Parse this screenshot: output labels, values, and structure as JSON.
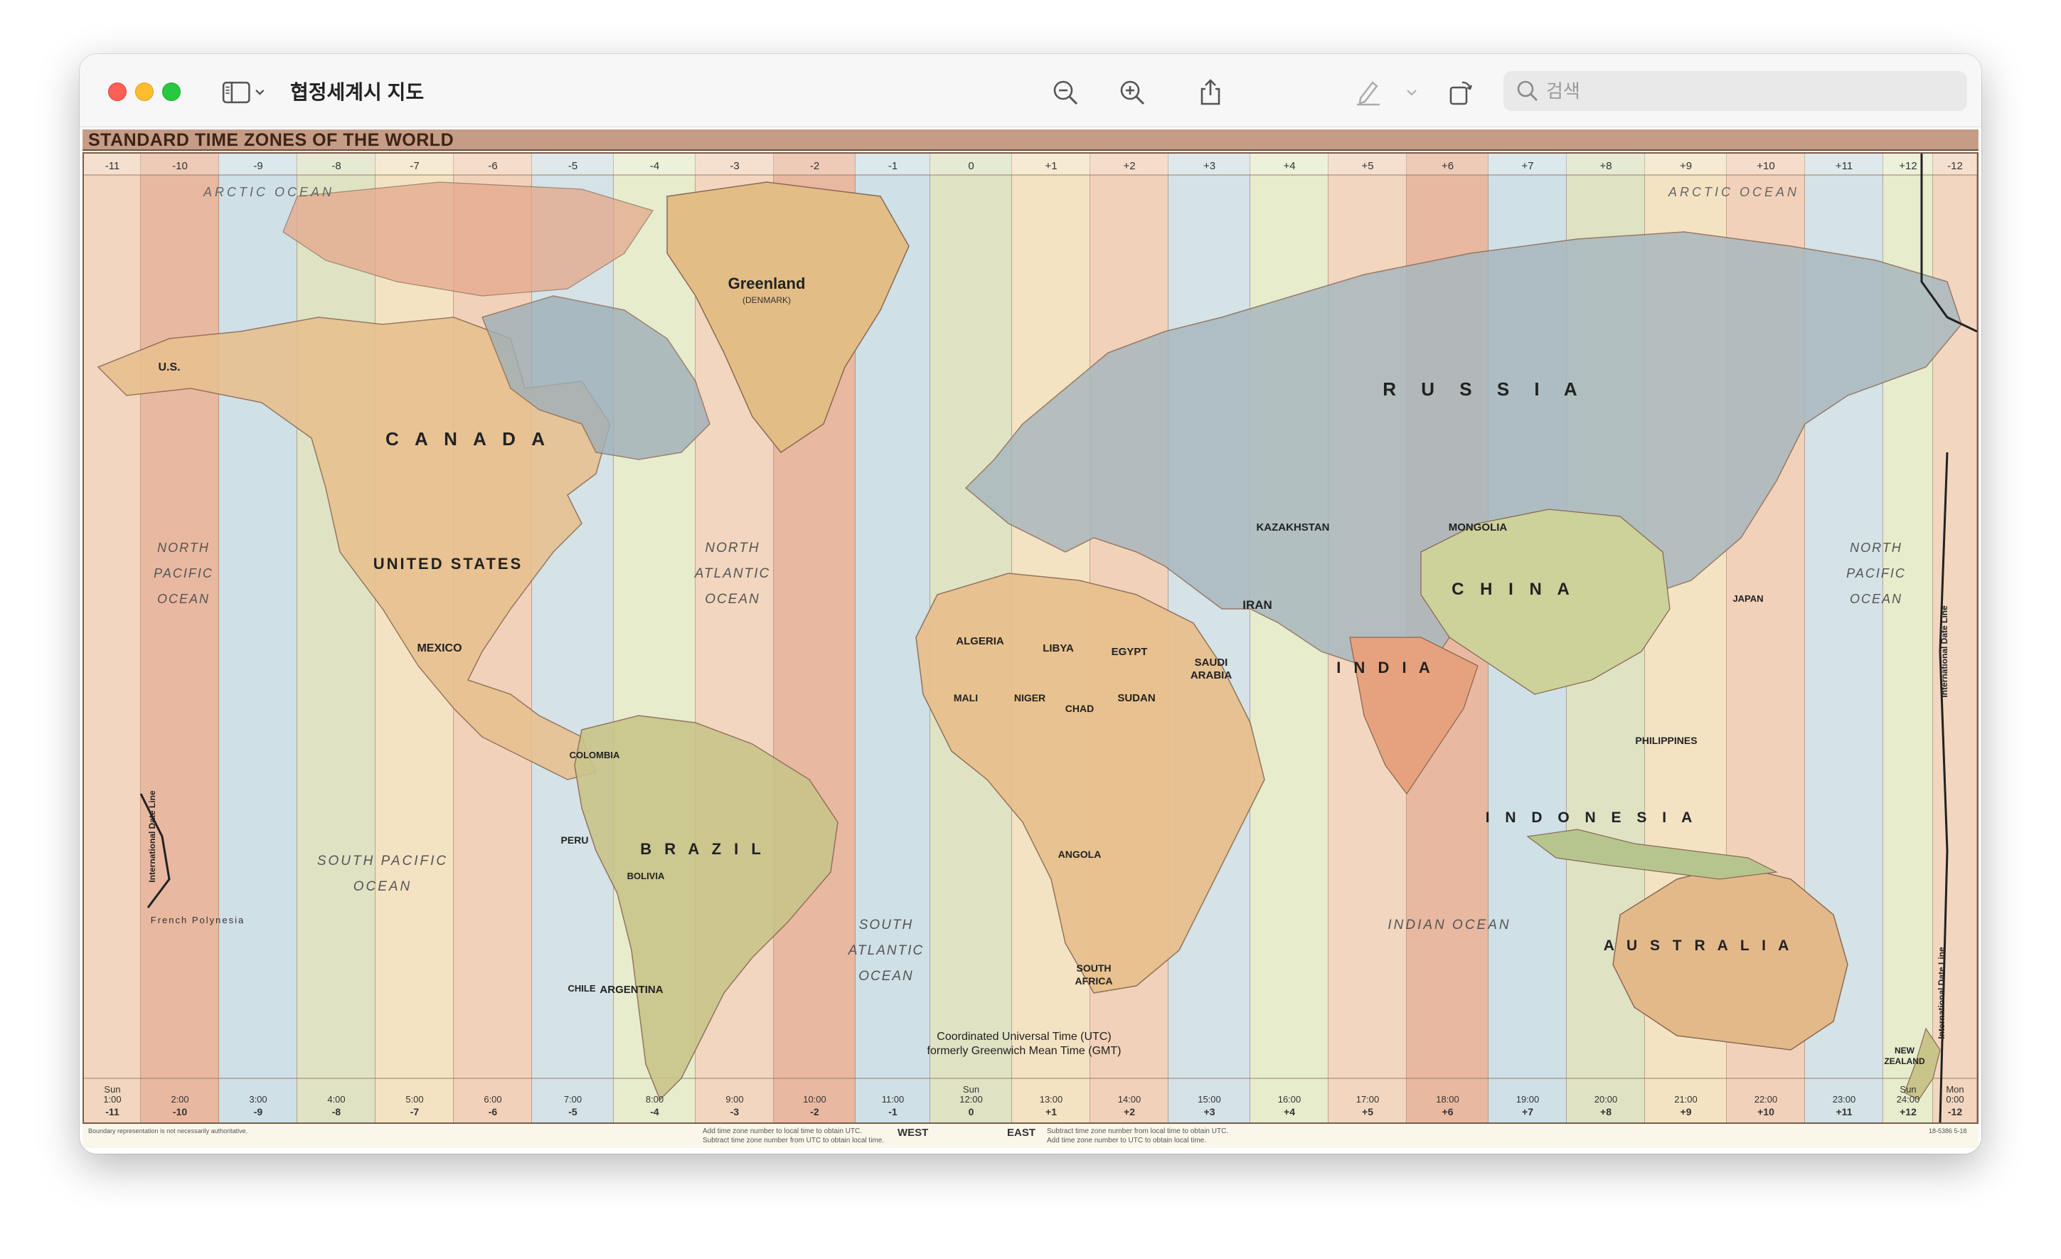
{
  "window": {
    "title": "협정세계시 지도",
    "search_placeholder": "검색"
  },
  "toolbar": {
    "icons": [
      "sidebar-icon",
      "chevron-down-icon",
      "zoom-out-icon",
      "zoom-in-icon",
      "share-icon",
      "highlight-icon",
      "chevron-down-icon",
      "rotate-icon",
      "markup-icon",
      "search-icon"
    ]
  },
  "map": {
    "title": "STANDARD TIME ZONES OF THE WORLD",
    "top_offsets": [
      "-11",
      "-10",
      "-9",
      "-8",
      "-7",
      "-6",
      "-5",
      "-4",
      "-3",
      "-2",
      "-1",
      "0",
      "+1",
      "+2",
      "+3",
      "+4",
      "+5",
      "+6",
      "+7",
      "+8",
      "+9",
      "+10",
      "+11",
      "+12",
      "-12",
      "-11"
    ],
    "bottom_times": [
      "Sun\n1:00",
      "2:00",
      "3:00",
      "4:00",
      "5:00",
      "6:00",
      "7:00",
      "8:00",
      "9:00",
      "10:00",
      "11:00",
      "Sun\n12:00",
      "13:00",
      "14:00",
      "15:00",
      "16:00",
      "17:00",
      "18:00",
      "19:00",
      "20:00",
      "21:00",
      "22:00",
      "23:00",
      "Sun\n24:00",
      "Mon\n0:00",
      "Sun\n1:00"
    ],
    "bottom_offsets": [
      "-11",
      "-10",
      "-9",
      "-8",
      "-7",
      "-6",
      "-5",
      "-4",
      "-3",
      "-2",
      "-1",
      "0",
      "+1",
      "+2",
      "+3",
      "+4",
      "+5",
      "+6",
      "+7",
      "+8",
      "+9",
      "+10",
      "+11",
      "+12",
      "-12",
      "-11"
    ],
    "labels": {
      "greenland": "Greenland",
      "greenland_sub": "(DENMARK)",
      "canada": "C A N A D A",
      "united_states": "UNITED STATES",
      "us_alaska": "U.S.",
      "mexico": "MEXICO",
      "brazil": "B R A Z I L",
      "argentina": "ARGENTINA",
      "peru": "PERU",
      "colombia": "COLOMBIA",
      "bolivia": "BOLIVIA",
      "chile": "CHILE",
      "russia": "R U S S I A",
      "china": "C H I N A",
      "india": "I N D I A",
      "kazakhstan": "KAZAKHSTAN",
      "mongolia": "MONGOLIA",
      "iran": "IRAN",
      "indonesia": "I N D O N E S I A",
      "australia": "A U S T R A L I A",
      "algeria": "ALGERIA",
      "libya": "LIBYA",
      "egypt": "EGYPT",
      "sudan": "SUDAN",
      "mali": "MALI",
      "niger": "NIGER",
      "chad": "CHAD",
      "saudi": "SAUDI",
      "arabia": "ARABIA",
      "angola": "ANGOLA",
      "south_africa": "SOUTH",
      "south_africa2": "AFRICA",
      "philippines": "PHILIPPINES",
      "japan": "JAPAN",
      "new_zealand": "NEW",
      "new_zealand2": "ZEALAND",
      "arctic_ocean_w": "ARCTIC   OCEAN",
      "arctic_ocean_e": "ARCTIC   OCEAN",
      "north_pacific_w": "NORTH",
      "north_pacific_w2": "PACIFIC",
      "north_pacific_w3": "OCEAN",
      "north_pacific_e": "NORTH",
      "north_pacific_e2": "PACIFIC",
      "north_pacific_e3": "OCEAN",
      "south_pacific": "SOUTH   PACIFIC",
      "south_pacific2": "OCEAN",
      "north_atlantic": "NORTH",
      "north_atlantic2": "ATLANTIC",
      "north_atlantic3": "OCEAN",
      "south_atlantic": "SOUTH",
      "south_atlantic2": "ATLANTIC",
      "south_atlantic3": "OCEAN",
      "indian_ocean": "INDIAN     OCEAN",
      "french_polynesia": "French Polynesia",
      "idl": "International Date Line",
      "utc_line1": "Coordinated Universal Time (UTC)",
      "utc_line2": "formerly Greenwich Mean Time (GMT)"
    },
    "footer": {
      "authoritative": "Boundary representation is not necessarily authoritative.",
      "west_note1": "Add time zone number to local time to obtain UTC.",
      "west_note2": "Subtract time zone number from UTC to obtain local time.",
      "west": "WEST",
      "east": "EAST",
      "east_note1": "Subtract time zone number from local time to obtain UTC.",
      "east_note2": "Add time zone number to UTC to obtain local time.",
      "code": "18-5386 5-18"
    }
  }
}
